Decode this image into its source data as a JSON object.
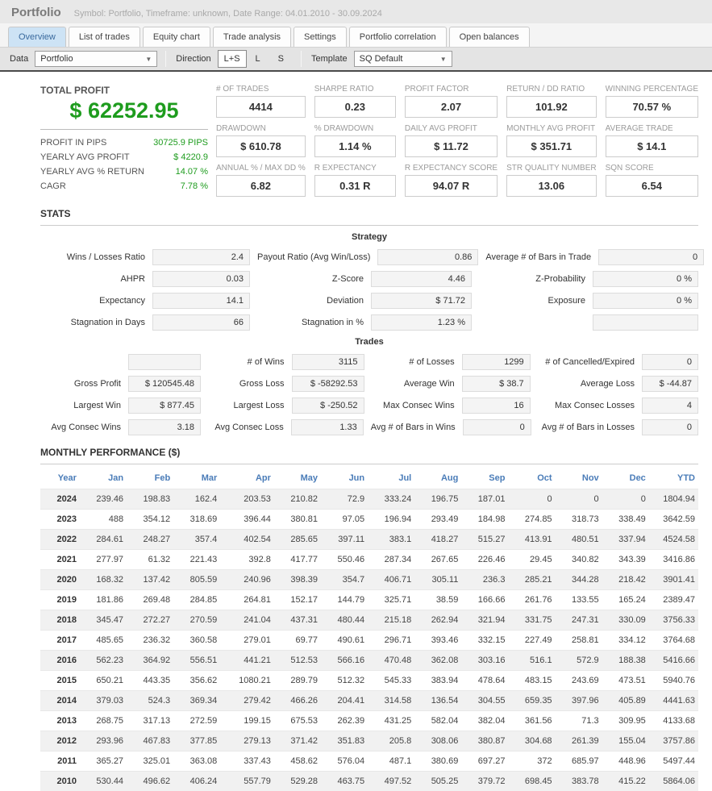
{
  "header": {
    "title": "Portfolio",
    "subtitle": "Symbol: Portfolio, Timeframe: unknown, Date Range: 04.01.2010 - 30.09.2024"
  },
  "tabs": [
    {
      "label": "Overview",
      "active": true
    },
    {
      "label": "List of trades",
      "active": false
    },
    {
      "label": "Equity chart",
      "active": false
    },
    {
      "label": "Trade analysis",
      "active": false
    },
    {
      "label": "Settings",
      "active": false
    },
    {
      "label": "Portfolio correlation",
      "active": false
    },
    {
      "label": "Open balances",
      "active": false
    }
  ],
  "toolbar": {
    "data_label": "Data",
    "data_value": "Portfolio",
    "dropdown_arrow_icon": "▼",
    "direction_label": "Direction",
    "direction_options": [
      "L+S",
      "L",
      "S"
    ],
    "direction_selected": "L+S",
    "template_label": "Template",
    "template_value": "SQ Default"
  },
  "colors": {
    "profit_green": "#1e9c1e",
    "table_header_blue": "#4a7cb8",
    "active_tab_bg": "#cde3f5"
  },
  "summary": {
    "total_profit_label": "TOTAL PROFIT",
    "total_profit_value": "$ 62252.95",
    "rows": [
      {
        "label": "PROFIT IN PIPS",
        "value": "30725.9 PIPS"
      },
      {
        "label": "YEARLY AVG PROFIT",
        "value": "$ 4220.9"
      },
      {
        "label": "YEARLY AVG % RETURN",
        "value": "14.07 %"
      },
      {
        "label": "CAGR",
        "value": "7.78 %"
      }
    ]
  },
  "metrics": [
    {
      "label": "# OF TRADES",
      "value": "4414"
    },
    {
      "label": "SHARPE RATIO",
      "value": "0.23"
    },
    {
      "label": "PROFIT FACTOR",
      "value": "2.07"
    },
    {
      "label": "RETURN / DD RATIO",
      "value": "101.92"
    },
    {
      "label": "WINNING PERCENTAGE",
      "value": "70.57 %"
    },
    {
      "label": "DRAWDOWN",
      "value": "$ 610.78"
    },
    {
      "label": "% DRAWDOWN",
      "value": "1.14 %"
    },
    {
      "label": "DAILY AVG PROFIT",
      "value": "$ 11.72"
    },
    {
      "label": "MONTHLY AVG PROFIT",
      "value": "$ 351.71"
    },
    {
      "label": "AVERAGE TRADE",
      "value": "$ 14.1"
    },
    {
      "label": "ANNUAL % / MAX DD %",
      "value": "6.82"
    },
    {
      "label": "R EXPECTANCY",
      "value": "0.31 R"
    },
    {
      "label": "R EXPECTANCY SCORE",
      "value": "94.07 R"
    },
    {
      "label": "STR QUALITY NUMBER",
      "value": "13.06"
    },
    {
      "label": "SQN SCORE",
      "value": "6.54"
    }
  ],
  "stats": {
    "section_title": "STATS",
    "strategy_title": "Strategy",
    "strategy_rows": [
      [
        {
          "label": "Wins / Losses Ratio",
          "value": "2.4"
        },
        {
          "label": "Payout Ratio (Avg Win/Loss)",
          "value": "0.86"
        },
        {
          "label": "Average # of Bars in Trade",
          "value": "0"
        }
      ],
      [
        {
          "label": "AHPR",
          "value": "0.03"
        },
        {
          "label": "Z-Score",
          "value": "4.46"
        },
        {
          "label": "Z-Probability",
          "value": "0 %"
        }
      ],
      [
        {
          "label": "Expectancy",
          "value": "14.1"
        },
        {
          "label": "Deviation",
          "value": "$ 71.72"
        },
        {
          "label": "Exposure",
          "value": "0 %"
        }
      ],
      [
        {
          "label": "Stagnation in Days",
          "value": "66"
        },
        {
          "label": "Stagnation in %",
          "value": "1.23 %"
        },
        {
          "label": "",
          "value": ""
        }
      ]
    ],
    "trades_title": "Trades",
    "trades_rows": [
      [
        {
          "label": "",
          "value": ""
        },
        {
          "label": "# of Wins",
          "value": "3115"
        },
        {
          "label": "# of Losses",
          "value": "1299"
        },
        {
          "label": "# of Cancelled/Expired",
          "value": "0"
        }
      ],
      [
        {
          "label": "Gross Profit",
          "value": "$ 120545.48"
        },
        {
          "label": "Gross Loss",
          "value": "$ -58292.53"
        },
        {
          "label": "Average Win",
          "value": "$ 38.7"
        },
        {
          "label": "Average Loss",
          "value": "$ -44.87"
        }
      ],
      [
        {
          "label": "Largest Win",
          "value": "$ 877.45"
        },
        {
          "label": "Largest Loss",
          "value": "$ -250.52"
        },
        {
          "label": "Max Consec Wins",
          "value": "16"
        },
        {
          "label": "Max Consec Losses",
          "value": "4"
        }
      ],
      [
        {
          "label": "Avg Consec Wins",
          "value": "3.18"
        },
        {
          "label": "Avg Consec Loss",
          "value": "1.33"
        },
        {
          "label": "Avg # of Bars in Wins",
          "value": "0"
        },
        {
          "label": "Avg # of Bars in Losses",
          "value": "0"
        }
      ]
    ]
  },
  "monthly": {
    "section_title": "MONTHLY PERFORMANCE ($)",
    "columns": [
      "Year",
      "Jan",
      "Feb",
      "Mar",
      "Apr",
      "May",
      "Jun",
      "Jul",
      "Aug",
      "Sep",
      "Oct",
      "Nov",
      "Dec",
      "YTD"
    ],
    "rows": [
      {
        "year": "2024",
        "values": [
          "239.46",
          "198.83",
          "162.4",
          "203.53",
          "210.82",
          "72.9",
          "333.24",
          "196.75",
          "187.01",
          "0",
          "0",
          "0",
          "1804.94"
        ]
      },
      {
        "year": "2023",
        "values": [
          "488",
          "354.12",
          "318.69",
          "396.44",
          "380.81",
          "97.05",
          "196.94",
          "293.49",
          "184.98",
          "274.85",
          "318.73",
          "338.49",
          "3642.59"
        ]
      },
      {
        "year": "2022",
        "values": [
          "284.61",
          "248.27",
          "357.4",
          "402.54",
          "285.65",
          "397.11",
          "383.1",
          "418.27",
          "515.27",
          "413.91",
          "480.51",
          "337.94",
          "4524.58"
        ]
      },
      {
        "year": "2021",
        "values": [
          "277.97",
          "61.32",
          "221.43",
          "392.8",
          "417.77",
          "550.46",
          "287.34",
          "267.65",
          "226.46",
          "29.45",
          "340.82",
          "343.39",
          "3416.86"
        ]
      },
      {
        "year": "2020",
        "values": [
          "168.32",
          "137.42",
          "805.59",
          "240.96",
          "398.39",
          "354.7",
          "406.71",
          "305.11",
          "236.3",
          "285.21",
          "344.28",
          "218.42",
          "3901.41"
        ]
      },
      {
        "year": "2019",
        "values": [
          "181.86",
          "269.48",
          "284.85",
          "264.81",
          "152.17",
          "144.79",
          "325.71",
          "38.59",
          "166.66",
          "261.76",
          "133.55",
          "165.24",
          "2389.47"
        ]
      },
      {
        "year": "2018",
        "values": [
          "345.47",
          "272.27",
          "270.59",
          "241.04",
          "437.31",
          "480.44",
          "215.18",
          "262.94",
          "321.94",
          "331.75",
          "247.31",
          "330.09",
          "3756.33"
        ]
      },
      {
        "year": "2017",
        "values": [
          "485.65",
          "236.32",
          "360.58",
          "279.01",
          "69.77",
          "490.61",
          "296.71",
          "393.46",
          "332.15",
          "227.49",
          "258.81",
          "334.12",
          "3764.68"
        ]
      },
      {
        "year": "2016",
        "values": [
          "562.23",
          "364.92",
          "556.51",
          "441.21",
          "512.53",
          "566.16",
          "470.48",
          "362.08",
          "303.16",
          "516.1",
          "572.9",
          "188.38",
          "5416.66"
        ]
      },
      {
        "year": "2015",
        "values": [
          "650.21",
          "443.35",
          "356.62",
          "1080.21",
          "289.79",
          "512.32",
          "545.33",
          "383.94",
          "478.64",
          "483.15",
          "243.69",
          "473.51",
          "5940.76"
        ]
      },
      {
        "year": "2014",
        "values": [
          "379.03",
          "524.3",
          "369.34",
          "279.42",
          "466.26",
          "204.41",
          "314.58",
          "136.54",
          "304.55",
          "659.35",
          "397.96",
          "405.89",
          "4441.63"
        ]
      },
      {
        "year": "2013",
        "values": [
          "268.75",
          "317.13",
          "272.59",
          "199.15",
          "675.53",
          "262.39",
          "431.25",
          "582.04",
          "382.04",
          "361.56",
          "71.3",
          "309.95",
          "4133.68"
        ]
      },
      {
        "year": "2012",
        "values": [
          "293.96",
          "467.83",
          "377.85",
          "279.13",
          "371.42",
          "351.83",
          "205.8",
          "308.06",
          "380.87",
          "304.68",
          "261.39",
          "155.04",
          "3757.86"
        ]
      },
      {
        "year": "2011",
        "values": [
          "365.27",
          "325.01",
          "363.08",
          "337.43",
          "458.62",
          "576.04",
          "487.1",
          "380.69",
          "697.27",
          "372",
          "685.97",
          "448.96",
          "5497.44"
        ]
      },
      {
        "year": "2010",
        "values": [
          "530.44",
          "496.62",
          "406.24",
          "557.79",
          "529.28",
          "463.75",
          "497.52",
          "505.25",
          "379.72",
          "698.45",
          "383.78",
          "415.22",
          "5864.06"
        ]
      }
    ]
  }
}
